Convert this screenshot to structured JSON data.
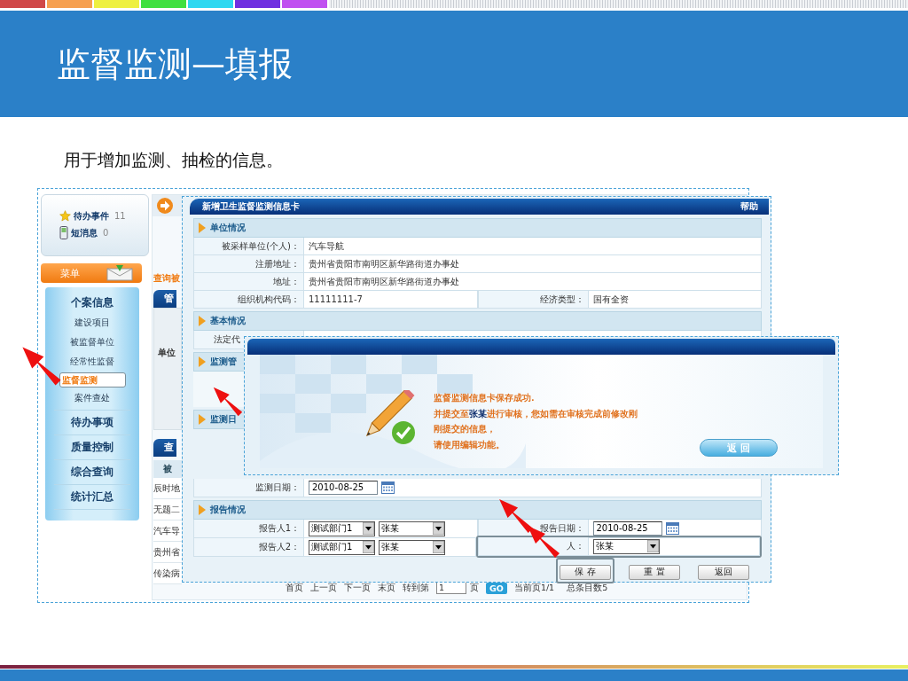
{
  "slide": {
    "title": "监督监测—填报",
    "subtitle": "用于增加监测、抽检的信息。"
  },
  "sidebar": {
    "notices": [
      {
        "label": "待办事件",
        "count": "11"
      },
      {
        "label": "短消息",
        "count": "0"
      }
    ],
    "menu_title": "菜单",
    "menu": [
      {
        "label": "个案信息",
        "selected": false,
        "children": [
          {
            "label": "建设项目",
            "selected": false,
            "highlighted": false
          },
          {
            "label": "被监督单位",
            "selected": false,
            "highlighted": false
          },
          {
            "label": "经常性监督",
            "selected": false,
            "highlighted": false
          },
          {
            "label": "监督监测",
            "selected": true,
            "highlighted": true
          },
          {
            "label": "案件查处",
            "selected": false,
            "highlighted": false
          }
        ]
      },
      {
        "label": "待办事项",
        "selected": false
      },
      {
        "label": "质量控制",
        "selected": false
      },
      {
        "label": "综合查询",
        "selected": false
      },
      {
        "label": "统计汇总",
        "selected": false
      }
    ]
  },
  "background_page": {
    "query_heading": "查询被",
    "tab_1": "管",
    "field_label": "单位",
    "tab_2": "查",
    "column_1": "被",
    "rows": [
      "辰时地",
      "无题二",
      "汽车导",
      "贵州省",
      "传染病"
    ],
    "pagination": {
      "links": [
        "首页",
        "上一页",
        "下一页",
        "末页"
      ],
      "goto_label": "转到第",
      "page_input": "1",
      "page_unit": "页",
      "go_button": "GO",
      "current": "当前页1/1",
      "total": "总条目数5"
    }
  },
  "form": {
    "title": "新增卫生监督监测信息卡",
    "help": "帮助",
    "sections": [
      {
        "title": "单位情况",
        "rows": [
          [
            {
              "label": "被采样单位(个人)：",
              "kind": "text",
              "value": "汽车导航"
            }
          ],
          [
            {
              "label": "注册地址：",
              "kind": "text",
              "value": "贵州省贵阳市南明区新华路街道办事处"
            }
          ],
          [
            {
              "label": "地址：",
              "kind": "text",
              "value": "贵州省贵阳市南明区新华路街道办事处"
            }
          ],
          [
            {
              "label": "组织机构代码：",
              "kind": "text",
              "value": "11111111-7"
            },
            {
              "label": "经济类型：",
              "kind": "text",
              "value": "国有全资"
            }
          ]
        ]
      },
      {
        "title": "基本情况",
        "rows": [
          [
            {
              "label": "法定代",
              "kind": "text"
            }
          ]
        ]
      },
      {
        "title": "监测管"
      },
      {
        "title": "监测日",
        "rows": [
          [
            {
              "label": "监测日期：",
              "kind": "date",
              "value": "2010-08-25"
            }
          ]
        ]
      },
      {
        "title": "报告情况",
        "rows": [
          [
            {
              "label": "报告人1：",
              "kind": "selects",
              "values": [
                "测试部门1",
                "张某"
              ],
              "highlighted": false
            },
            {
              "label": "报告日期：",
              "kind": "date",
              "value": "2010-08-25",
              "highlighted": false
            }
          ],
          [
            {
              "label": "报告人2：",
              "kind": "selects",
              "values": [
                "测试部门1",
                "张某"
              ],
              "highlighted": false
            },
            {
              "label": "人：",
              "kind": "select",
              "value": "张某",
              "highlighted": true
            }
          ]
        ]
      }
    ],
    "buttons": [
      {
        "label": "保 存",
        "highlighted": true
      },
      {
        "label": "重 置",
        "highlighted": false
      },
      {
        "label": "返回",
        "highlighted": false
      }
    ]
  },
  "dialog": {
    "lines": [
      "监督监测信息卡保存成功.",
      "并提交至**张某**进行审核，您如需在审核完成前修改刚",
      "刚提交的信息，",
      "请使用编辑功能。"
    ],
    "button": "返 回"
  }
}
